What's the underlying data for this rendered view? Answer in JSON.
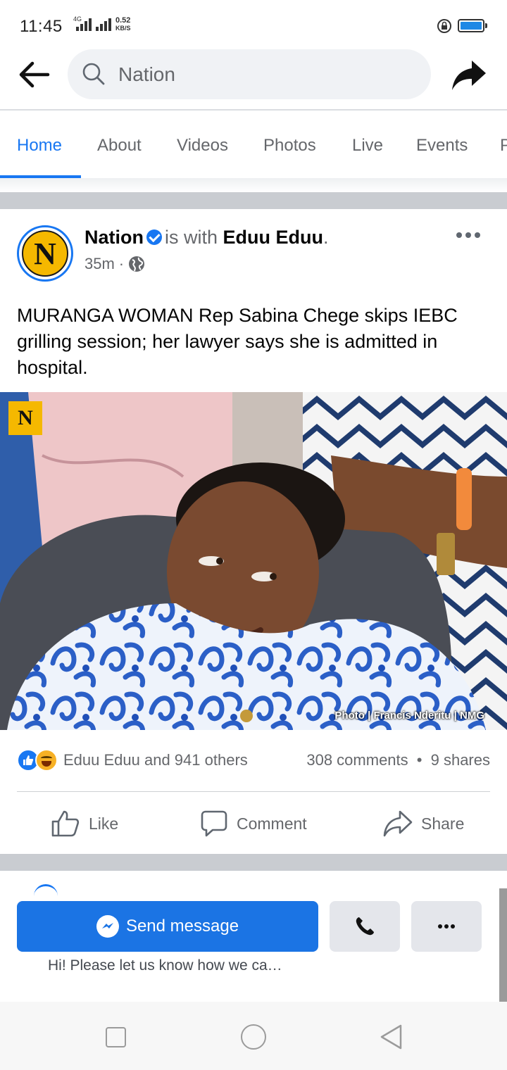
{
  "status_bar": {
    "time": "11:45",
    "network_type": "4G",
    "speed_value": "0.52",
    "speed_unit": "KB/S",
    "battery_color": "#1e88e5"
  },
  "header": {
    "back_icon": "arrow-left-icon",
    "search_placeholder": "Nation",
    "share_icon": "share-arrow-icon"
  },
  "tabs": [
    {
      "label": "Home",
      "active": true
    },
    {
      "label": "About",
      "active": false
    },
    {
      "label": "Videos",
      "active": false
    },
    {
      "label": "Photos",
      "active": false
    },
    {
      "label": "Live",
      "active": false
    },
    {
      "label": "Events",
      "active": false
    },
    {
      "label": "P",
      "active": false
    }
  ],
  "post": {
    "avatar_letter": "N",
    "page_name": "Nation",
    "with_text": "is with",
    "tagged_name": "Eduu Eduu",
    "tagged_suffix": ".",
    "time_ago": "35m",
    "separator": "·",
    "audience_icon": "globe-icon",
    "text": "MURANGA WOMAN Rep Sabina Chege skips IEBC grilling session; her lawyer says she is admitted in hospital.",
    "photo_badge": "N",
    "photo_credit": "Photo | Francis Nderitu | NMG"
  },
  "engagement": {
    "reaction_icons": [
      "like-reaction-icon",
      "haha-reaction-icon"
    ],
    "reactors": "Eduu Eduu and 941 others",
    "comments": "308 comments",
    "dot": "•",
    "shares": "9 shares"
  },
  "actions": {
    "like": "Like",
    "comment": "Comment",
    "share": "Share"
  },
  "cta": {
    "send_label": "Send message",
    "hint": "Hi! Please let us know how we ca…"
  },
  "colors": {
    "accent": "#1877f2",
    "brand_yellow": "#f5b800",
    "muted_text": "#65676b"
  }
}
